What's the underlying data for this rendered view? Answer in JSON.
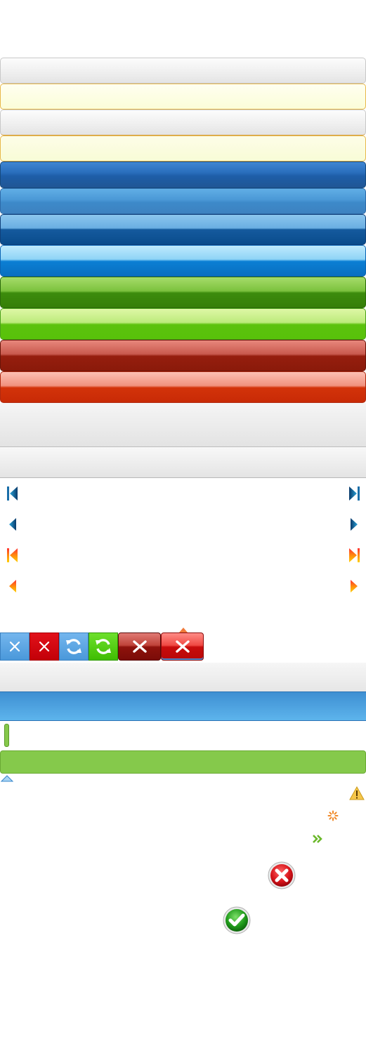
{
  "colors": {
    "accent_blue": "#3f86d2",
    "accent_green": "#5cc20e",
    "accent_red": "#c82a06",
    "progress_green": "#85c94b",
    "highlight_yellow": "#fbfdd8"
  },
  "icons": {
    "nav_blue": [
      "first-page-icon",
      "last-page-icon",
      "previous-icon",
      "next-icon"
    ],
    "nav_orange": [
      "first-page-icon",
      "last-page-icon",
      "previous-icon",
      "next-icon"
    ],
    "tiles": [
      "close-icon",
      "close-icon",
      "refresh-icon",
      "refresh-icon",
      "close-icon",
      "close-icon"
    ],
    "status": [
      "warning-icon",
      "spinner-icon",
      "double-chevron-right-icon",
      "error-icon",
      "success-icon"
    ]
  }
}
